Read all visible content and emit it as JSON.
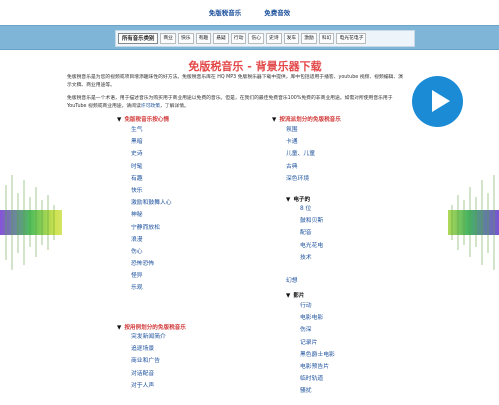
{
  "top_nav": [
    "免版税音乐",
    "免费音效"
  ],
  "category_tabs": [
    "所有音乐类别",
    "商业",
    "快乐",
    "有趣",
    "悬疑",
    "行动",
    "伤心",
    "史诗",
    "发车",
    "激励",
    "科幻",
    "电光花电子"
  ],
  "title": "免版税音乐 - 背景乐器下载",
  "intro": {
    "p1": "免版税音乐是为您的视频或项目增添趣味性的好方法。免版税音乐库在 HQ MP3 免版税乐器下载中提供，库中包括适用于播客、youtube 视频、视频编辑、演示文稿、商业用途等。",
    "p2_text": "免版税音乐是一个术语，用于描述音乐为购买用于商业用途以免费的音乐。但是，在我们的最佳免费音乐100%免费的非商业用途。如需对所使用音乐用于 YouTube 视频或商业用途，请阅读",
    "p2_link": "许可政策",
    "p2_end": "，了解详情。"
  },
  "left_col": {
    "section1": {
      "title": "免版税音乐按心情",
      "items": [
        "生气",
        "黑暗",
        "史诗",
        "时髦",
        "有趣",
        "快乐",
        "激励和鼓舞人心",
        "神秘",
        "宁静而放松",
        "浪漫",
        "伤心",
        "恐怖恐怖",
        "怪异",
        "乐观"
      ]
    },
    "section2": {
      "title": "按用例划分的免版税音乐",
      "items": [
        "突发新闻简介",
        "追逐场景",
        "商业和广告",
        "对话配音",
        "对于人声"
      ]
    }
  },
  "right_col": {
    "section1": {
      "title": "按流派划分的免版税音乐",
      "items": [
        "氛围",
        "卡通",
        "儿童、儿童",
        "古典",
        "深色环境"
      ]
    },
    "electronic": {
      "title": "电子的",
      "items": [
        "8 位",
        "鼓和贝斯",
        "配音",
        "电光花电",
        "技术"
      ]
    },
    "after_electronic": [
      "幻想"
    ],
    "film": {
      "title": "影片",
      "items": [
        "行动",
        "电影电影",
        "伤深",
        "记录片",
        "黑色爵士电影",
        "电影预告片",
        "临时轨道",
        "骚扰"
      ]
    }
  },
  "colors": {
    "accent_red": "#d23a3a",
    "link_blue": "#1a4f9c",
    "band_blue": "#7fb6d8",
    "play_blue": "#1b8bd6"
  },
  "icons": {
    "play": "play-button-icon",
    "disclosure": "triangle-down-icon"
  }
}
